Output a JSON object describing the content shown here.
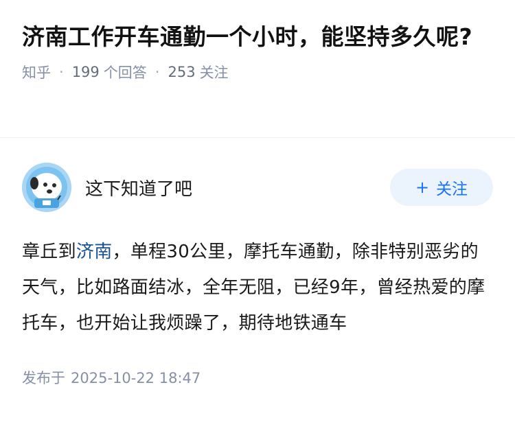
{
  "question": {
    "title": "济南工作开车通勤一个小时，能坚持多久呢?",
    "source": "知乎",
    "separator": "·",
    "answer_count": "199",
    "answer_label": "个回答",
    "follow_count": "253",
    "follow_label": "关注"
  },
  "answer": {
    "author_name": "这下知道了吧",
    "follow_button": {
      "icon": "plus-icon",
      "label": "关注"
    },
    "content_prefix": "章丘到",
    "content_link": "济南",
    "content_suffix": "，单程30公里，摩托车通勤，除非特别恶劣的天气，比如路面结冰，全年无阻，已经9年，曾经热爱的摩托车，也开始让我烦躁了，期待地铁通车",
    "published_label": "发布于",
    "published_time": "2025-10-22 18:47"
  },
  "colors": {
    "accent": "#1772f6",
    "link": "#175199",
    "meta": "#8590a6",
    "follow_bg": "#ebf3fd"
  }
}
